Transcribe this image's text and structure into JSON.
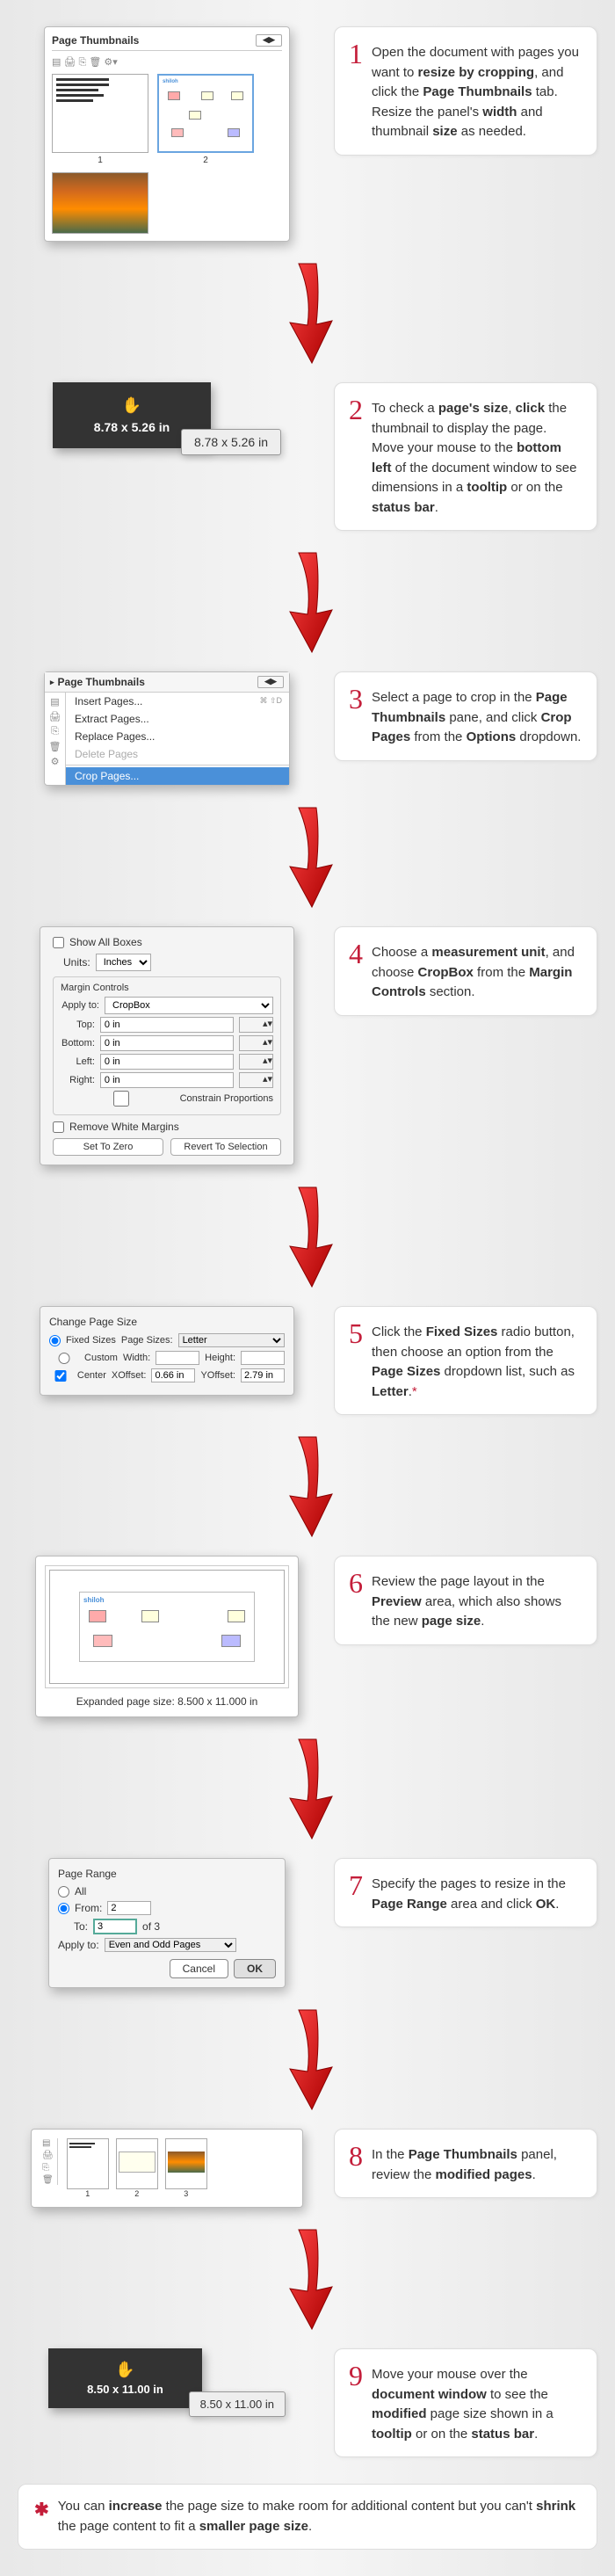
{
  "steps": {
    "s1": {
      "num": "1",
      "text_a": "Open the document with pages you want to ",
      "b1": "resize by cropping",
      "text_b": ", and click the ",
      "b2": "Page Thumbnails",
      "text_c": " tab. Resize the panel's ",
      "b3": "width",
      "text_d": " and thumbnail ",
      "b4": "size",
      "text_e": " as needed.",
      "panel_title": "Page Thumbnails",
      "thumb1": "1",
      "thumb2": "2"
    },
    "s2": {
      "num": "2",
      "a": "To check a ",
      "b1": "page's size",
      "c": ", ",
      "b2": "click",
      "d": " the thumbnail to display the page. Move your mouse to the ",
      "b3": "bottom left",
      "e": " of the document window to see dimensions in a ",
      "b4": "tooltip",
      "f": " or on the ",
      "b5": "status bar",
      "g": ".",
      "dim": "8.78 x 5.26 in",
      "dim2": "8.78 x 5.26 in"
    },
    "s3": {
      "num": "3",
      "a": "Select a page to crop in the ",
      "b1": "Page Thumbnails",
      "c": " pane, and click ",
      "b2": "Crop Pages",
      "d": " from the ",
      "b3": "Options",
      "e": " dropdown.",
      "title": "Page Thumbnails",
      "m1": "Insert Pages...",
      "m2": "Extract Pages...",
      "m3": "Replace Pages...",
      "m4": "Delete Pages",
      "m5": "Crop Pages...",
      "kd": "⌘ ⇧D"
    },
    "s4": {
      "num": "4",
      "a": "Choose a ",
      "b1": "measurement unit",
      "c": ", and choose ",
      "b2": "CropBox",
      "d": " from the ",
      "b3": "Margin Controls",
      "e": " section.",
      "show_all": "Show All Boxes",
      "units_label": "Units:",
      "units_val": "Inches",
      "mc_title": "Margin Controls",
      "apply_label": "Apply to:",
      "apply_val": "CropBox",
      "top": "Top:",
      "bottom": "Bottom:",
      "left": "Left:",
      "right": "Right:",
      "zero": "0 in",
      "constrain": "Constrain Proportions",
      "remove_white": "Remove White Margins",
      "btn1": "Set To Zero",
      "btn2": "Revert To Selection"
    },
    "s5": {
      "num": "5",
      "a": "Click the ",
      "b1": "Fixed Sizes",
      "c": " radio button, then choose an option from the ",
      "b2": "Page Sizes",
      "d": " dropdown list, such as ",
      "b3": "Letter",
      "e": ".",
      "title": "Change Page Size",
      "fixed": "Fixed Sizes",
      "ps_label": "Page Sizes:",
      "ps_val": "Letter",
      "custom": "Custom",
      "width_l": "Width:",
      "height_l": "Height:",
      "center": "Center",
      "xoff_l": "XOffset:",
      "xoff_v": "0.66 in",
      "yoff_l": "YOffset:",
      "yoff_v": "2.79 in"
    },
    "s6": {
      "num": "6",
      "a": "Review the page layout in the ",
      "b1": "Preview",
      "c": " area, which also shows the new ",
      "b2": "page size",
      "d": ".",
      "label_pre": "Expanded page size:",
      "label_val": "8.500 x 11.000 in"
    },
    "s7": {
      "num": "7",
      "a": "Specify the pages to resize in the ",
      "b1": "Page Range",
      "c": " area and click ",
      "b2": "OK",
      "d": ".",
      "title": "Page Range",
      "all": "All",
      "from": "From:",
      "from_v": "2",
      "to": "To:",
      "to_v": "3",
      "of": "of 3",
      "apply_l": "Apply to:",
      "apply_v": "Even and Odd Pages",
      "cancel": "Cancel",
      "ok": "OK"
    },
    "s8": {
      "num": "8",
      "a": "In the ",
      "b1": "Page Thumbnails",
      "c": " panel, review the ",
      "b2": "modified pages",
      "d": ".",
      "p1": "1",
      "p2": "2",
      "p3": "3"
    },
    "s9": {
      "num": "9",
      "a": "Move your mouse over the ",
      "b1": "document window",
      "c": " to see the ",
      "b2": "modified",
      "d": " page size shown in a ",
      "b3": "tooltip",
      "e": " or on the ",
      "b4": "status bar",
      "f": ".",
      "dim": "8.50 x 11.00 in",
      "dim2": "8.50 x 11.00 in"
    }
  },
  "footnote": {
    "star": "✱",
    "a": "You can ",
    "b1": "increase",
    "c": " the page size to make room for additional content but you can't ",
    "b2": "shrink",
    "d": " the page content to fit a ",
    "b3": "smaller page size",
    "e": "."
  }
}
